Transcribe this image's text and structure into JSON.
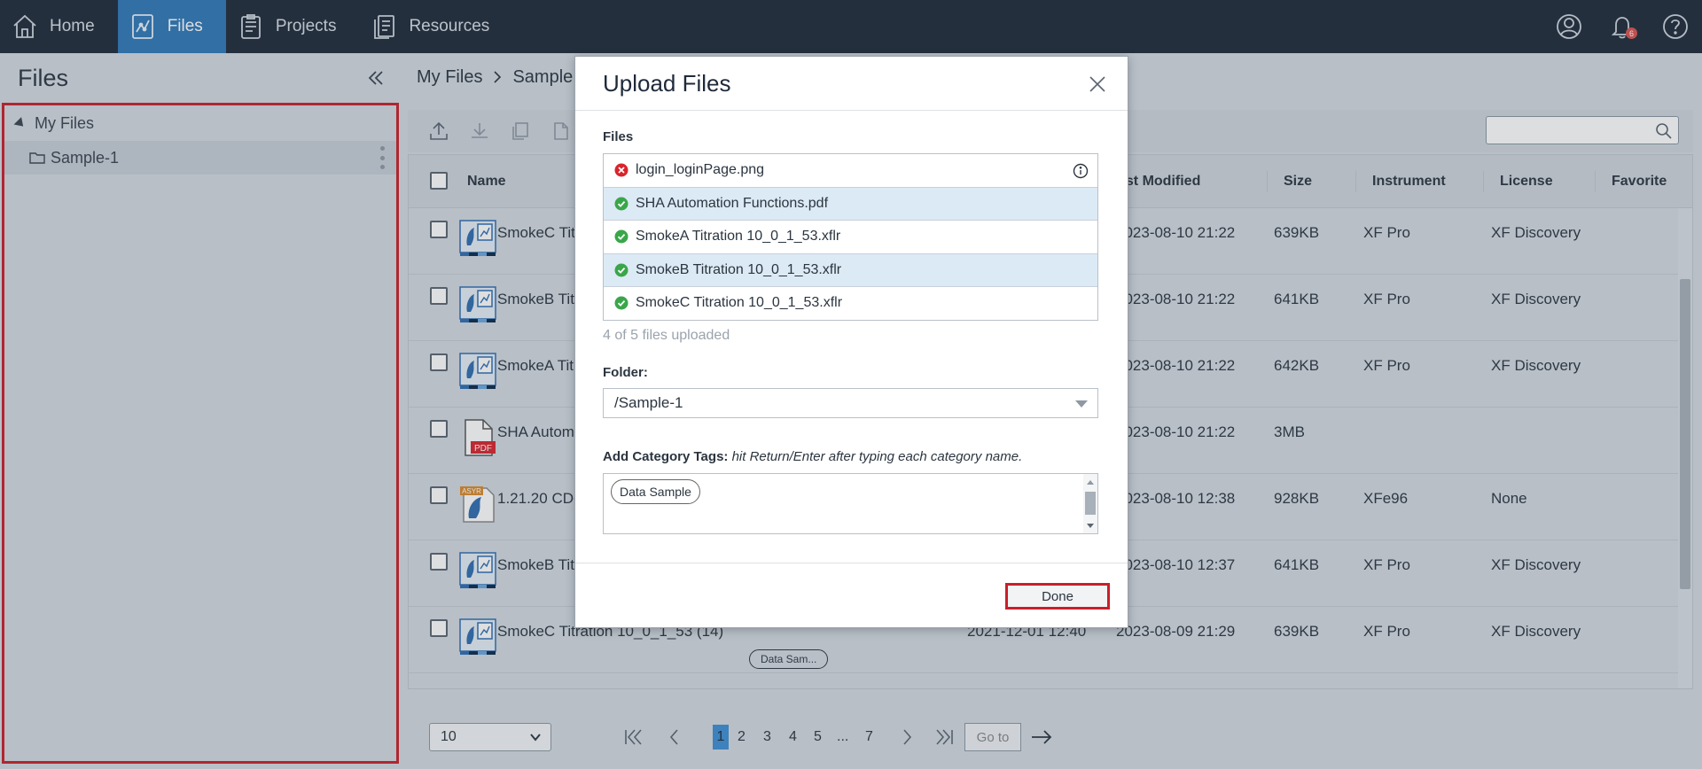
{
  "nav": {
    "items": [
      {
        "label": "Home",
        "icon": "home-icon"
      },
      {
        "label": "Files",
        "icon": "files-chart-icon",
        "active": true
      },
      {
        "label": "Projects",
        "icon": "projects-icon"
      },
      {
        "label": "Resources",
        "icon": "resources-icon"
      }
    ],
    "notification_count": "6"
  },
  "sidebar": {
    "title": "Files",
    "tree": {
      "root": "My Files",
      "children": [
        "Sample-1"
      ]
    }
  },
  "main": {
    "breadcrumb": [
      "My Files",
      "Sample"
    ],
    "columns": {
      "name": "Name",
      "last_modified": "ast Modified",
      "size": "Size",
      "instrument": "Instrument",
      "license": "License",
      "favorite": "Favorite"
    },
    "rows": [
      {
        "name": "SmokeC Tit",
        "mid": "",
        "modified": "2023-08-10 21:22",
        "size": "639KB",
        "instrument": "XF Pro",
        "license": "XF Discovery",
        "icon": "xflr"
      },
      {
        "name": "SmokeB Tit",
        "mid": "",
        "modified": "2023-08-10 21:22",
        "size": "641KB",
        "instrument": "XF Pro",
        "license": "XF Discovery",
        "icon": "xflr"
      },
      {
        "name": "SmokeA Tit",
        "mid": "",
        "modified": "2023-08-10 21:22",
        "size": "642KB",
        "instrument": "XF Pro",
        "license": "XF Discovery",
        "icon": "xflr"
      },
      {
        "name": "SHA Autom",
        "mid": "",
        "modified": "2023-08-10 21:22",
        "size": "3MB",
        "instrument": "",
        "license": "",
        "icon": "pdf"
      },
      {
        "name": "1.21.20 CD-",
        "mid": "",
        "modified": "2023-08-10 12:38",
        "size": "928KB",
        "instrument": "XFe96",
        "license": "None",
        "icon": "asyr"
      },
      {
        "name": "SmokeB Tit",
        "mid": "",
        "modified": "2023-08-10 12:37",
        "size": "641KB",
        "instrument": "XF Pro",
        "license": "XF Discovery",
        "icon": "xflr"
      },
      {
        "name": "SmokeC Titration 10_0_1_53 (14)",
        "mid": "2021-12-01 12:40",
        "modified": "2023-08-09 21:29",
        "size": "639KB",
        "instrument": "XF Pro",
        "license": "XF Discovery",
        "icon": "xflr",
        "tag": "Data Sam..."
      }
    ],
    "pager": {
      "page_size": "10",
      "pages": [
        "1",
        "2",
        "3",
        "4",
        "5",
        "...",
        "7"
      ],
      "goto_placeholder": "Go to"
    }
  },
  "modal": {
    "title": "Upload Files",
    "files_label": "Files",
    "files": [
      {
        "name": "login_loginPage.png",
        "status": "error"
      },
      {
        "name": "SHA Automation Functions.pdf",
        "status": "ok"
      },
      {
        "name": "SmokeA Titration 10_0_1_53.xflr",
        "status": "ok"
      },
      {
        "name": "SmokeB Titration 10_0_1_53.xflr",
        "status": "ok"
      },
      {
        "name": "SmokeC Titration 10_0_1_53.xflr",
        "status": "ok"
      }
    ],
    "progress": "4 of 5 files uploaded",
    "folder_label": "Folder:",
    "folder_value": "/Sample-1",
    "tags_label": "Add Category Tags:",
    "tags_hint": "hit Return/Enter after typing each category name.",
    "tags": [
      "Data Sample"
    ],
    "done_label": "Done"
  },
  "colors": {
    "nav_bg": "#1f2a3a",
    "nav_active": "#2f78b7",
    "highlight": "#c81f2a",
    "ok": "#3aa64a",
    "error": "#d9242c"
  }
}
